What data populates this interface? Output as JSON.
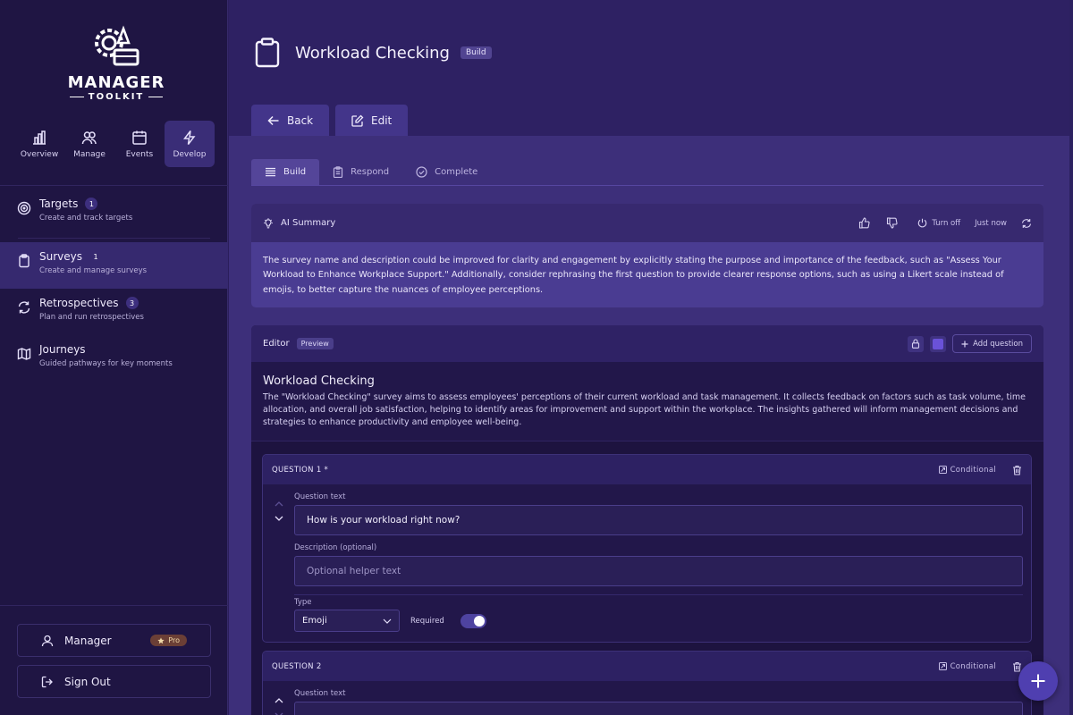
{
  "brand": {
    "title": "MANAGER",
    "subtitle": "TOOLKIT"
  },
  "topnav": [
    {
      "label": "Overview",
      "icon": "bar-chart-icon"
    },
    {
      "label": "Manage",
      "icon": "users-icon"
    },
    {
      "label": "Events",
      "icon": "calendar-icon"
    },
    {
      "label": "Develop",
      "icon": "lightning-icon",
      "active": true
    }
  ],
  "sidebar": {
    "items": [
      {
        "title": "Targets",
        "badge": "1",
        "sub": "Create and track targets",
        "icon": "target-icon"
      },
      {
        "title": "Surveys",
        "badge": "1",
        "sub": "Create and manage surveys",
        "icon": "clipboard-icon",
        "active": true
      },
      {
        "title": "Retrospectives",
        "badge": "3",
        "sub": "Plan and run retrospectives",
        "icon": "refresh-icon"
      },
      {
        "title": "Journeys",
        "badge": "",
        "sub": "Guided pathways for key moments",
        "icon": "map-icon"
      }
    ],
    "user_label": "Manager",
    "pro_label": "Pro",
    "signout_label": "Sign Out"
  },
  "header": {
    "title": "Workload Checking",
    "badge": "Build",
    "back_label": "Back",
    "edit_label": "Edit"
  },
  "tabs": [
    {
      "label": "Build",
      "active": true
    },
    {
      "label": "Respond"
    },
    {
      "label": "Complete"
    }
  ],
  "ai_summary": {
    "title": "AI Summary",
    "turn_off": "Turn off",
    "timestamp": "Just now",
    "text": "The survey name and description could be improved for clarity and engagement by explicitly stating the purpose and importance of the feedback, such as \"Assess Your Workload to Enhance Workplace Support.\" Additionally, consider rephrasing the first question to provide clearer response options, such as using a Likert scale instead of emojis, to better capture the nuances of employee perceptions."
  },
  "editor": {
    "title": "Editor",
    "preview_badge": "Preview",
    "add_question": "Add question",
    "survey_title": "Workload Checking",
    "survey_description": "The \"Workload Checking\" survey aims to assess employees' perceptions of their current workload and task management. It collects feedback on factors such as task volume, time allocation, and overall job satisfaction, helping to identify areas for improvement and support within the workplace. The insights gathered will inform management decisions and strategies to enhance productivity and employee well-being.",
    "questions": [
      {
        "label": "QUESTION 1 *",
        "conditional": "Conditional",
        "text_label": "Question text",
        "text_value": "How is your workload right now?",
        "desc_label": "Description (optional)",
        "desc_placeholder": "Optional helper text",
        "type_label": "Type",
        "type_value": "Emoji",
        "required_label": "Required",
        "required": true
      },
      {
        "label": "QUESTION 2",
        "conditional": "Conditional",
        "text_label": "Question text"
      }
    ]
  },
  "colors": {
    "accent": "#4f3fb0",
    "sidebar_bg": "#1f1543",
    "main_bg": "#3d2f7a"
  }
}
